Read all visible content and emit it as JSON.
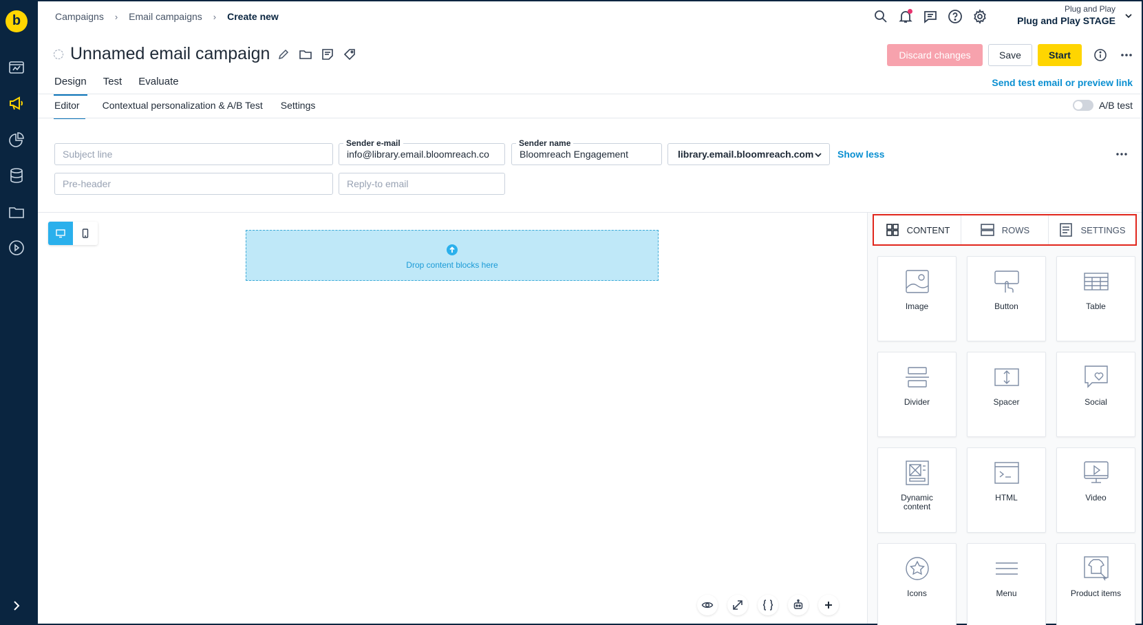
{
  "breadcrumb": [
    "Campaigns",
    "Email campaigns",
    "Create new"
  ],
  "project": {
    "org": "Plug and Play",
    "name": "Plug and Play STAGE"
  },
  "campaign": {
    "title": "Unnamed email campaign"
  },
  "actions": {
    "discard": "Discard changes",
    "save": "Save",
    "start": "Start"
  },
  "main_tabs": [
    "Design",
    "Test",
    "Evaluate"
  ],
  "send_test_link": "Send test email or preview link",
  "sub_tabs": [
    "Editor",
    "Contextual personalization & A/B Test",
    "Settings"
  ],
  "ab_test_label": "A/B test",
  "form": {
    "subject_placeholder": "Subject line",
    "sender_email_label": "Sender e-mail",
    "sender_email_value": "info@library.email.bloomreach.co",
    "sender_name_label": "Sender name",
    "sender_name_value": "Bloomreach Engagement",
    "domain_value": "library.email.bloomreach.com",
    "show_less": "Show less",
    "preheader_placeholder": "Pre-header",
    "reply_to_placeholder": "Reply-to email"
  },
  "canvas": {
    "drop_text": "Drop content blocks here"
  },
  "panel_tabs": [
    "CONTENT",
    "ROWS",
    "SETTINGS"
  ],
  "blocks": [
    {
      "label": "Image",
      "icon": "image-icon"
    },
    {
      "label": "Button",
      "icon": "button-icon"
    },
    {
      "label": "Table",
      "icon": "table-icon"
    },
    {
      "label": "Divider",
      "icon": "divider-icon"
    },
    {
      "label": "Spacer",
      "icon": "spacer-icon"
    },
    {
      "label": "Social",
      "icon": "social-icon"
    },
    {
      "label": "Dynamic content",
      "icon": "dynamic-content-icon"
    },
    {
      "label": "HTML",
      "icon": "html-icon"
    },
    {
      "label": "Video",
      "icon": "video-icon"
    },
    {
      "label": "Icons",
      "icon": "icons-icon"
    },
    {
      "label": "Menu",
      "icon": "menu-icon"
    },
    {
      "label": "Product items",
      "icon": "product-items-icon"
    }
  ],
  "colors": {
    "rail": "#0a2540",
    "accent": "#ffd500",
    "link": "#0a8fd1",
    "discard": "#f7a2ad",
    "highlight": "#e1251b"
  }
}
